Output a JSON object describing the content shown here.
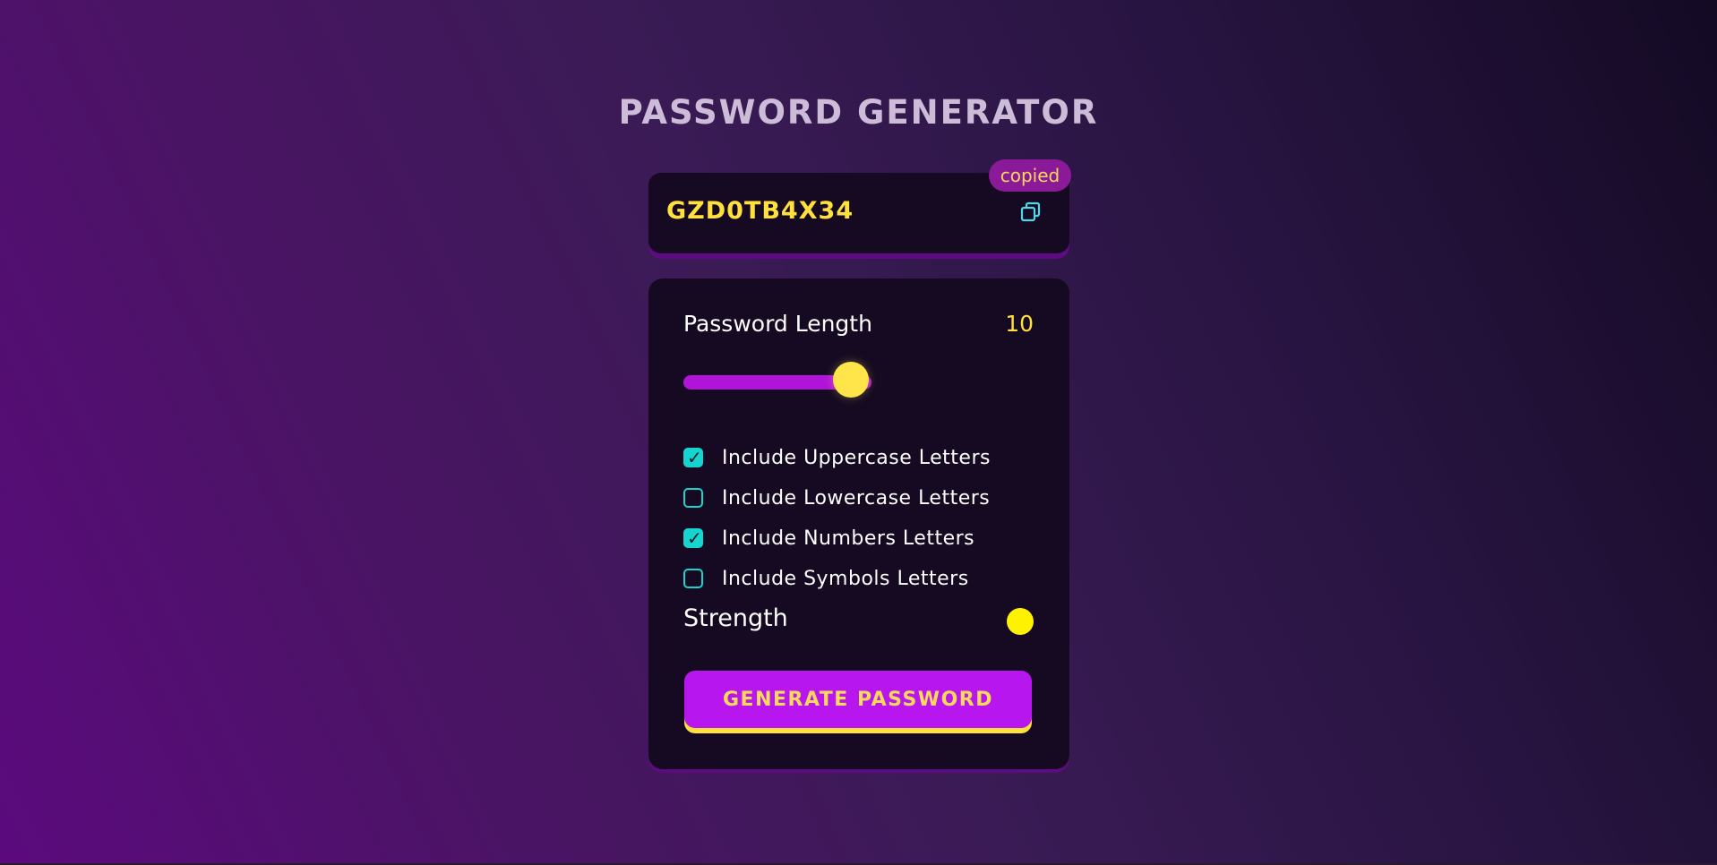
{
  "app": {
    "title": "PASSWORD GENERATOR"
  },
  "password": {
    "value": "GZD0TB4X34",
    "copy_icon": "copy-icon",
    "copied_label": "copied"
  },
  "length": {
    "label": "Password Length",
    "value": "10",
    "slider_fraction": 0.45
  },
  "options": [
    {
      "label": "Include Uppercase Letters",
      "checked": true
    },
    {
      "label": "Include Lowercase Letters",
      "checked": false
    },
    {
      "label": "Include Numbers Letters",
      "checked": true
    },
    {
      "label": "Include Symbols Letters",
      "checked": false
    }
  ],
  "strength": {
    "label": "Strength",
    "indicator_color": "#fff200"
  },
  "generate_button": {
    "label": "GENERATE PASSWORD"
  },
  "colors": {
    "accent_yellow": "#ffe03c",
    "accent_purple": "#b816ee",
    "check_teal": "#16d4d0"
  }
}
